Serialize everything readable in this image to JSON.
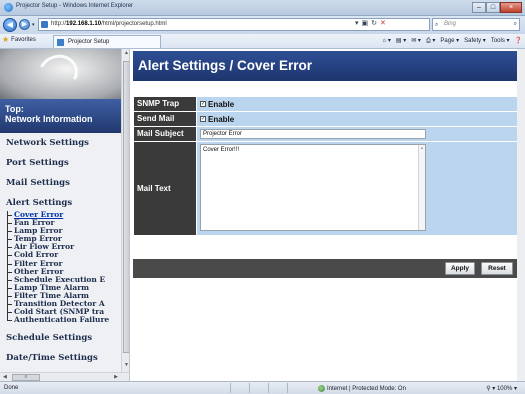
{
  "window": {
    "title": "Projector Setup - Windows Internet Explorer",
    "controls": {
      "minimize": "–",
      "maximize": "□",
      "close": "×"
    }
  },
  "browser": {
    "url_prefix": "http://",
    "url_host": "192.168.1.10",
    "url_path": "/html/projectorsetup.html",
    "search_placeholder": "Bing",
    "favorites_label": "Favorites",
    "tab_title": "Projector Setup",
    "command_bar": [
      "Page ▾",
      "Safety ▾",
      "Tools ▾"
    ]
  },
  "sidebar": {
    "top_label_line1": "Top:",
    "top_label_line2": "Network Information",
    "links": {
      "network": "Network Settings",
      "port": "Port Settings",
      "mail": "Mail Settings",
      "alert": "Alert Settings",
      "schedule": "Schedule Settings",
      "datetime": "Date/Time Settings"
    },
    "alert_items": [
      "Cover Error",
      "Fan Error",
      "Lamp Error",
      "Temp Error",
      "Air Flow Error",
      "Cold Error",
      "Filter Error",
      "Other Error",
      "Schedule Execution E",
      "Lamp Time Alarm",
      "Filter Time Alarm",
      "Transition Detector A",
      "Cold Start (SNMP tra",
      "Authentication Failure"
    ]
  },
  "main": {
    "title": "Alert Settings / Cover Error",
    "fields": {
      "snmp_trap_label": "SNMP Trap",
      "snmp_trap_option": "Enable",
      "snmp_trap_checked": true,
      "send_mail_label": "Send Mail",
      "send_mail_option": "Enable",
      "send_mail_checked": true,
      "mail_subject_label": "Mail Subject",
      "mail_subject_value": "Projector Error",
      "mail_text_label": "Mail Text",
      "mail_text_value": "Cover Error!!!"
    },
    "buttons": {
      "apply": "Apply",
      "reset": "Reset"
    }
  },
  "statusbar": {
    "left": "Done",
    "zone": "Internet | Protected Mode: On",
    "zoom": "100%"
  },
  "colors": {
    "header_blue": "#2f4f95",
    "label_dark": "#3a3a3a",
    "value_blue": "#bcd5ef",
    "footer_dark": "#4a4a4a"
  }
}
